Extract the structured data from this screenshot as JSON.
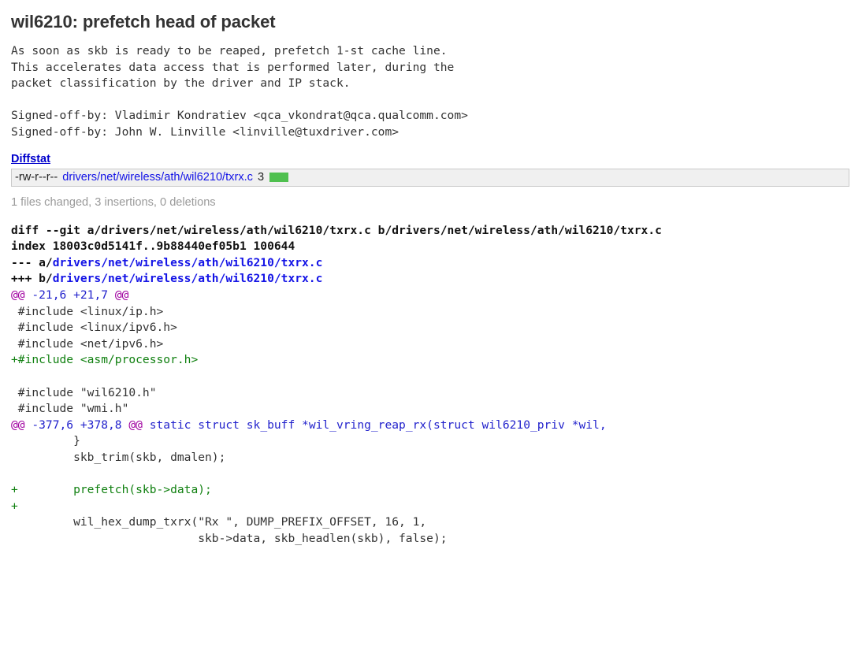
{
  "commit": {
    "title": "wil6210: prefetch head of packet",
    "message": "As soon as skb is ready to be reaped, prefetch 1-st cache line.\nThis accelerates data access that is performed later, during the\npacket classification by the driver and IP stack.\n\nSigned-off-by: Vladimir Kondratiev <qca_vkondrat@qca.qualcomm.com>\nSigned-off-by: John W. Linville <linville@tuxdriver.com>"
  },
  "diffstat": {
    "heading": "Diffstat",
    "rows": [
      {
        "mode": "-rw-r--r--",
        "path": "drivers/net/wireless/ath/wil6210/txrx.c",
        "count": "3",
        "added_blocks": 1
      }
    ],
    "summary": "1 files changed, 3 insertions, 0 deletions"
  },
  "diff": {
    "header": [
      {
        "type": "head",
        "text": "diff --git a/drivers/net/wireless/ath/wil6210/txrx.c b/drivers/net/wireless/ath/wil6210/txrx.c"
      },
      {
        "type": "head",
        "text": "index 18003c0d5141f..9b88440ef05b1 100644"
      },
      {
        "type": "head-path",
        "prefix": "--- a/",
        "path": "drivers/net/wireless/ath/wil6210/txrx.c"
      },
      {
        "type": "head-path",
        "prefix": "+++ b/",
        "path": "drivers/net/wireless/ath/wil6210/txrx.c"
      }
    ],
    "hunks": [
      {
        "at_open": "@@",
        "range": " -21,6 +21,7 ",
        "at_close": "@@",
        "context": "",
        "lines": [
          {
            "type": "ctx",
            "text": " #include <linux/ip.h>"
          },
          {
            "type": "ctx",
            "text": " #include <linux/ipv6.h>"
          },
          {
            "type": "ctx",
            "text": " #include <net/ipv6.h>"
          },
          {
            "type": "add",
            "text": "+#include <asm/processor.h>"
          },
          {
            "type": "ctx",
            "text": " "
          },
          {
            "type": "ctx",
            "text": " #include \"wil6210.h\""
          },
          {
            "type": "ctx",
            "text": " #include \"wmi.h\""
          }
        ]
      },
      {
        "at_open": "@@",
        "range": " -377,6 +378,8 ",
        "at_close": "@@",
        "context": " static struct sk_buff *wil_vring_reap_rx(struct wil6210_priv *wil,",
        "lines": [
          {
            "type": "ctx",
            "text": "         }"
          },
          {
            "type": "ctx",
            "text": "         skb_trim(skb, dmalen);"
          },
          {
            "type": "ctx",
            "text": " "
          },
          {
            "type": "add",
            "text": "+        prefetch(skb->data);"
          },
          {
            "type": "add",
            "text": "+"
          },
          {
            "type": "ctx",
            "text": "         wil_hex_dump_txrx(\"Rx \", DUMP_PREFIX_OFFSET, 16, 1,"
          },
          {
            "type": "ctx",
            "text": "                           skb->data, skb_headlen(skb), false);"
          }
        ]
      }
    ]
  }
}
